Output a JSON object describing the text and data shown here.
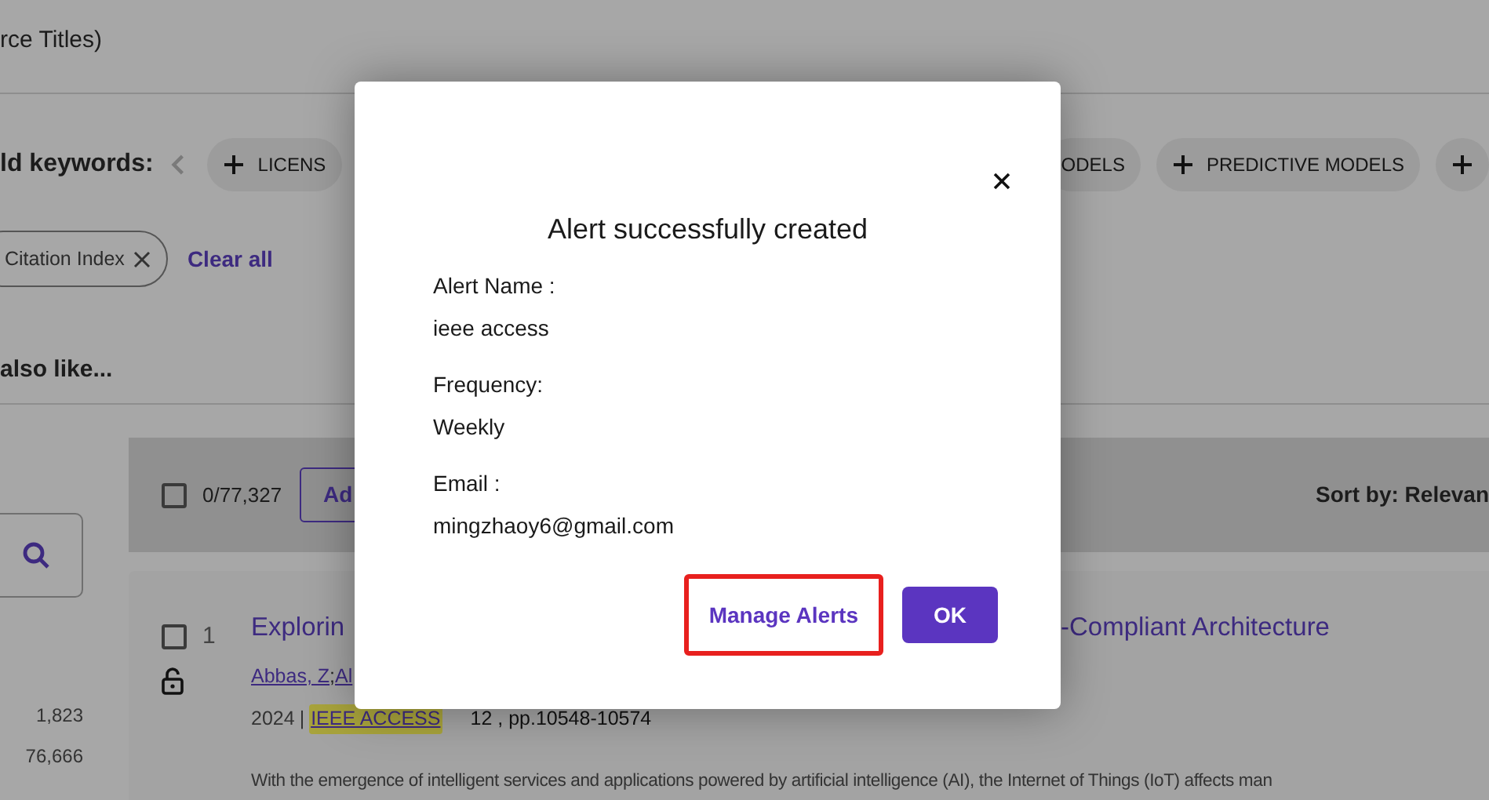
{
  "header": {
    "breadcrumb_tail": "rce Titles)"
  },
  "keywords": {
    "label": "ld keywords:",
    "chips_before_dialog": [
      {
        "label": "LICENS"
      }
    ],
    "chips_after_dialog": [
      {
        "label": "ODELS",
        "plus_visible": false
      },
      {
        "label": "PREDICTIVE MODELS",
        "plus_visible": true
      },
      {
        "plus_visible": true
      }
    ]
  },
  "filters": {
    "chips": [
      {
        "label": "Citation Index"
      }
    ],
    "clear": "Clear all"
  },
  "suggestion_heading": "also like...",
  "sidebar": {
    "counts": [
      "1,823",
      "76,666"
    ]
  },
  "toolbar": {
    "checked": false,
    "selection": "0/77,327",
    "add_button": "Ad",
    "sort": "Sort by: Relevan"
  },
  "results": [
    {
      "checked": false,
      "index": "1",
      "locked": false,
      "title_start": "Explorin",
      "title_end": "-Compliant Architecture",
      "authors": [
        "Abbas, Z",
        "Al"
      ],
      "author_separator": ";",
      "year": "2024",
      "year_separator": "|",
      "source": "IEEE ACCESS",
      "source_highlighted": true,
      "pages": "12 , pp.10548-10574",
      "abstract": "With the emergence of intelligent services and applications powered by artificial intelligence (AI), the Internet of Things (IoT) affects man"
    }
  ],
  "dialog": {
    "title": "Alert successfully created",
    "fields": [
      {
        "label": "Alert Name :",
        "value": "ieee access"
      },
      {
        "label": "Frequency:",
        "value": "Weekly"
      },
      {
        "label": "Email :",
        "value": "mingzhaoy6@gmail.com"
      }
    ],
    "buttons": [
      {
        "label": "Manage Alerts",
        "kind": "link",
        "highlighted": true
      },
      {
        "label": "OK",
        "kind": "primary",
        "highlighted": false
      }
    ]
  }
}
